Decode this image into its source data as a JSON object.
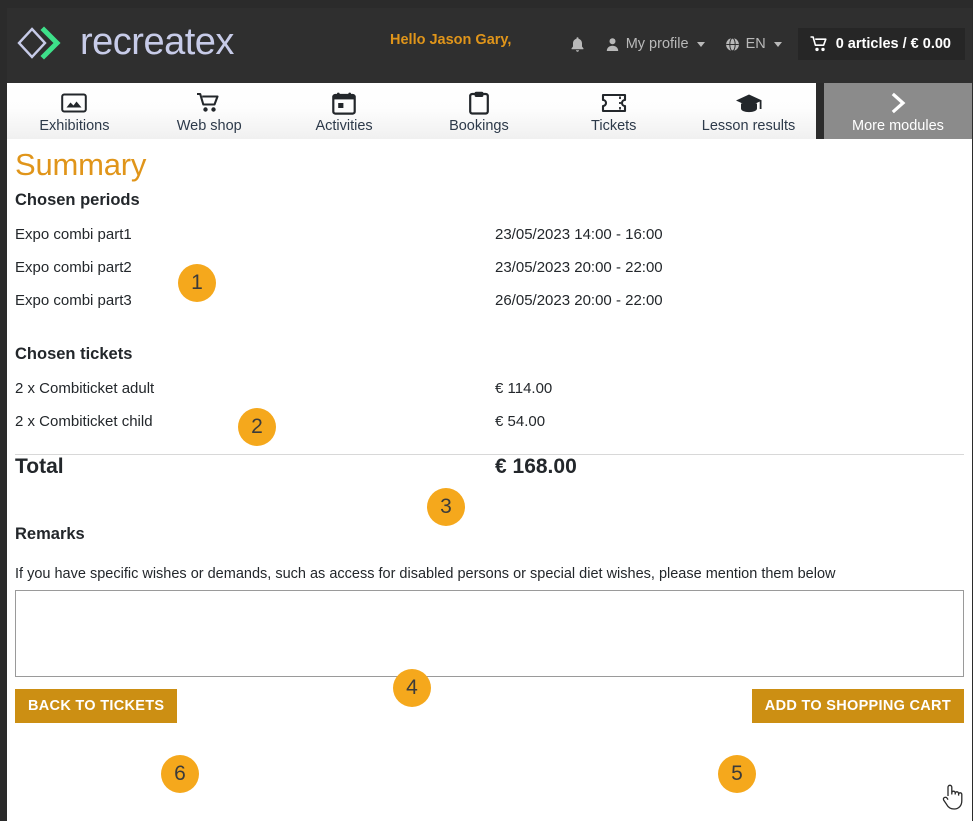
{
  "header": {
    "brand": "recreatex",
    "greeting": "Hello Jason Gary,",
    "notifications_icon": "bell-icon",
    "profile_label": "My profile",
    "language_label": "EN",
    "cart_label": "0 articles / € 0.00",
    "brand_text_color": "#c7cbe8",
    "greeting_color": "#e0951a",
    "background": "#2f2f2f"
  },
  "nav": {
    "items": [
      {
        "label": "Exhibitions",
        "icon": "image-icon"
      },
      {
        "label": "Web shop",
        "icon": "shopping-cart-icon"
      },
      {
        "label": "Activities",
        "icon": "calendar-icon"
      },
      {
        "label": "Bookings",
        "icon": "clipboard-icon"
      },
      {
        "label": "Tickets",
        "icon": "ticket-icon"
      },
      {
        "label": "Lesson results",
        "icon": "graduation-cap-icon"
      }
    ],
    "more": {
      "label": "More modules",
      "icon": "chevron-right-icon",
      "background": "#8b8b8b"
    }
  },
  "main": {
    "title": "Summary",
    "title_color": "#e0951a",
    "periods_heading": "Chosen periods",
    "periods": [
      {
        "name": "Expo combi part1",
        "datetime": "23/05/2023 14:00 - 16:00"
      },
      {
        "name": "Expo combi part2",
        "datetime": "23/05/2023 20:00 - 22:00"
      },
      {
        "name": "Expo combi part3",
        "datetime": "26/05/2023 20:00 - 22:00"
      }
    ],
    "tickets_heading": "Chosen tickets",
    "tickets": [
      {
        "name": "2 x Combiticket adult",
        "price": "€ 114.00"
      },
      {
        "name": "2 x Combiticket child",
        "price": "€ 54.00"
      }
    ],
    "total_label": "Total",
    "total_value": "€ 168.00",
    "remarks_heading": "Remarks",
    "remarks_description": "If you have specific wishes or demands, such as access for disabled persons or special diet wishes, please mention them below",
    "remarks_value": "",
    "remarks_placeholder": "",
    "back_button": "BACK TO TICKETS",
    "add_button": "ADD TO SHOPPING CART",
    "button_color": "#cc8f13"
  },
  "annotations": {
    "badge_color": "#f5a81c",
    "items": [
      {
        "number": "1"
      },
      {
        "number": "2"
      },
      {
        "number": "3"
      },
      {
        "number": "4"
      },
      {
        "number": "5"
      },
      {
        "number": "6"
      }
    ]
  }
}
